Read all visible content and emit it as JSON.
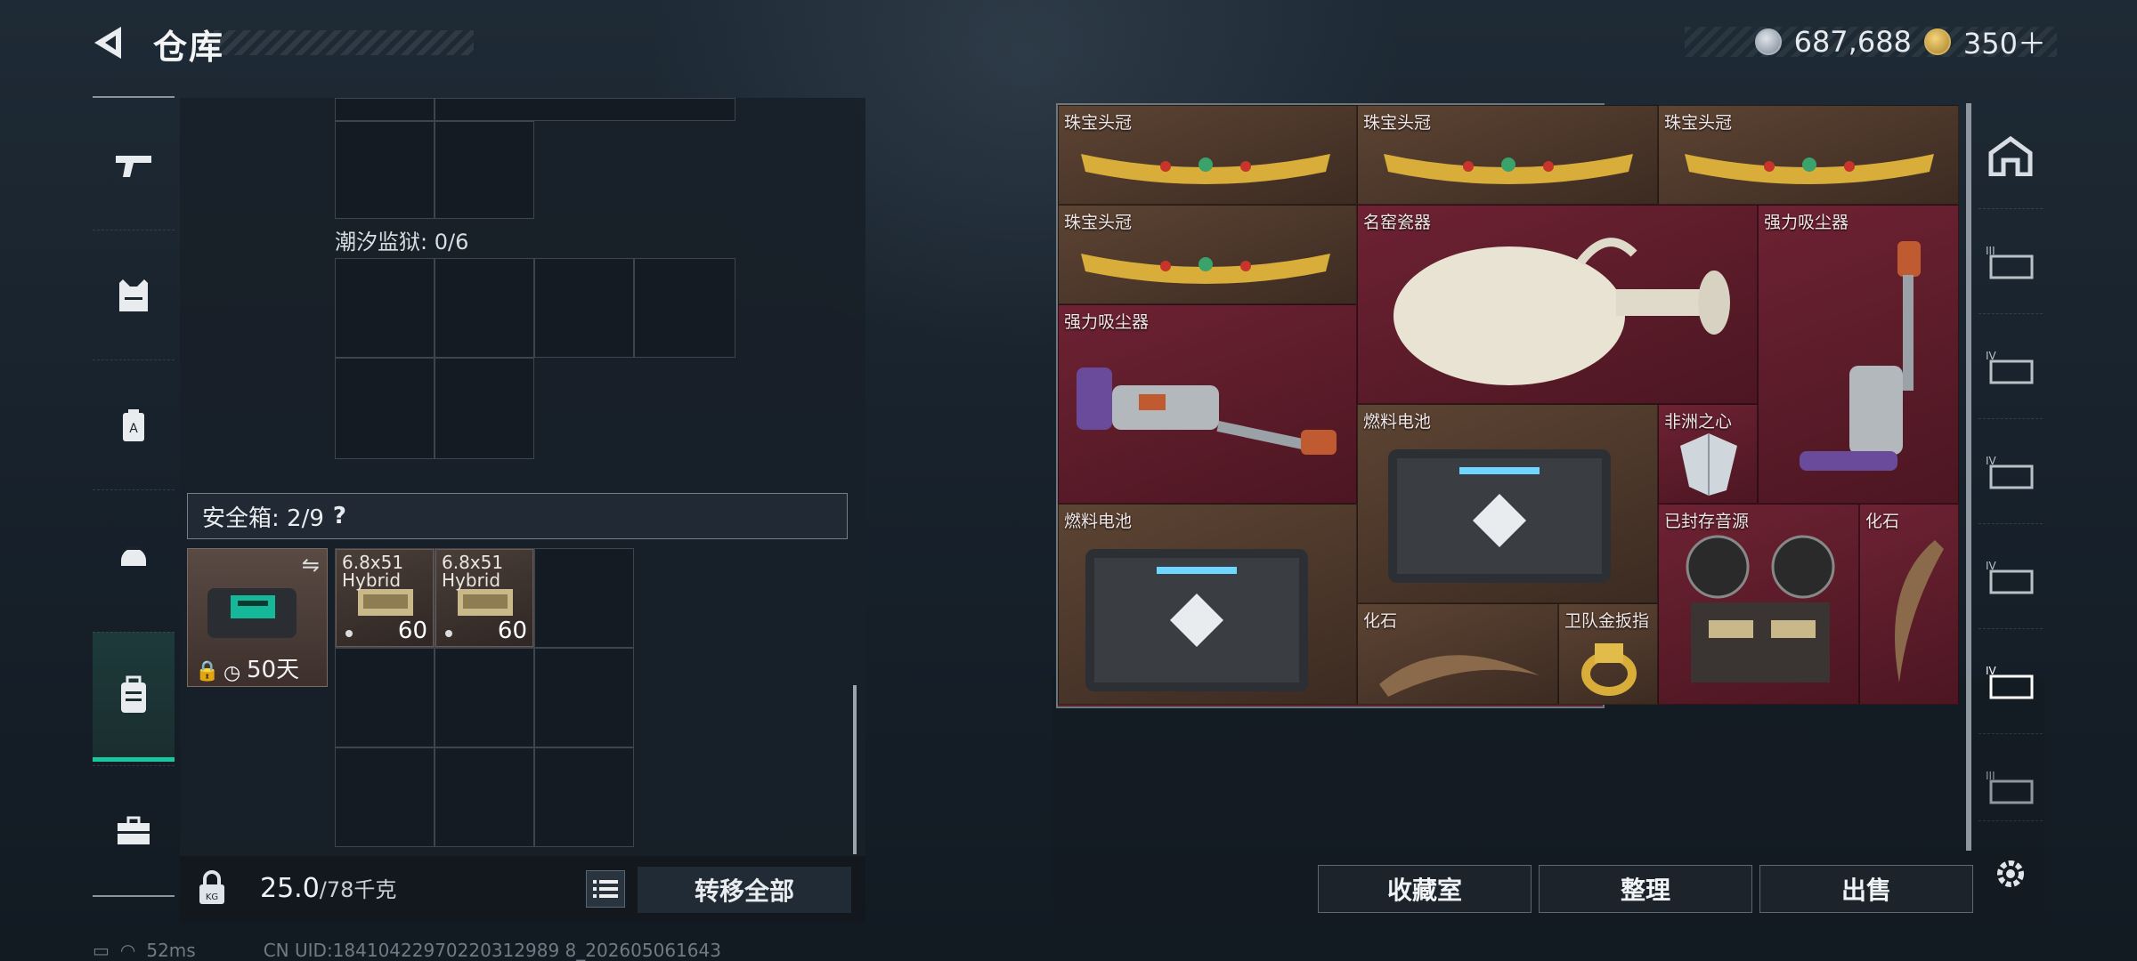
{
  "header": {
    "title": "仓库",
    "currency_silver": "687,688",
    "currency_gold": "350＋"
  },
  "inventory": {
    "prison_label": "潮汐监狱: 0/6",
    "safe_label": "安全箱: 2/9",
    "safe_help": "?",
    "safe_expiry": "50天",
    "ammo": [
      {
        "name": "6.8x51 Hybrid",
        "count": "60"
      },
      {
        "name": "6.8x51 Hybrid",
        "count": "60"
      }
    ],
    "weight": "25.0",
    "weight_max": "/78千克",
    "transfer_all": "转移全部"
  },
  "stash": {
    "items": [
      {
        "name": "珠宝头冠",
        "bg": "brown"
      },
      {
        "name": "珠宝头冠",
        "bg": "brown"
      },
      {
        "name": "珠宝头冠",
        "bg": "brown"
      },
      {
        "name": "珠宝头冠",
        "bg": "brown"
      },
      {
        "name": "名窑瓷器",
        "bg": "maroon"
      },
      {
        "name": "强力吸尘器",
        "bg": "maroon"
      },
      {
        "name": "强力吸尘器",
        "bg": "maroon"
      },
      {
        "name": "燃料电池",
        "bg": "brown"
      },
      {
        "name": "非洲之心",
        "bg": "maroon"
      },
      {
        "name": "燃料电池",
        "bg": "brown"
      },
      {
        "name": "化石",
        "bg": "brown"
      },
      {
        "name": "卫队金扳指",
        "bg": "brown"
      },
      {
        "name": "已封存音源",
        "bg": "maroon"
      },
      {
        "name": "化石",
        "bg": "maroon"
      }
    ],
    "buttons": {
      "collection": "收藏室",
      "sort": "整理",
      "sell": "出售"
    }
  },
  "status": {
    "ping": "52ms",
    "uid": "CN UID:18410422970220312989 8_202605061643"
  },
  "colors": {
    "accent": "#19c7a0",
    "stash_bg": "#5b2230",
    "brown_item": "#4d382b"
  }
}
